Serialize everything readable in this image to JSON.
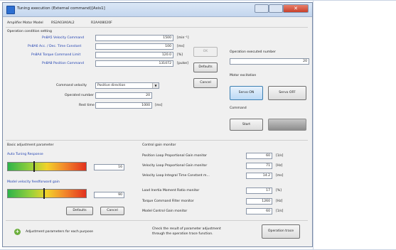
{
  "window": {
    "title": "Tuning execution (External command)[Axis1]",
    "close_glyph": "✕"
  },
  "amplifier": {
    "label": "Amplifier Motor Model",
    "amp_model": "RS2A03A0AL2",
    "motor_model": "R2AA08020F"
  },
  "operation": {
    "section_title": "Operation condition setting",
    "rows": [
      {
        "label": "Pn8A5 Velocity Command",
        "value": "1500",
        "unit": "[min⁻¹]"
      },
      {
        "label": "Pn8A6 Acc. / Dec. Time Constant",
        "value": "100",
        "unit": "[ms]"
      },
      {
        "label": "Pn8A4 Torque Command Limit",
        "value": "120.0",
        "unit": "[%]"
      },
      {
        "label": "Pn8A8 Position Command",
        "value": "131072",
        "unit": "[pulse]"
      }
    ],
    "command_velocity_label": "Command velocity",
    "command_velocity_value": "Positive direction",
    "operated_number_label": "Operated number",
    "operated_number_value": "20",
    "rest_time_label": "Rest time",
    "rest_time_value": "1000",
    "rest_time_unit": "[ms]",
    "ok_label": "OK",
    "to_defaults_label": "Defaults",
    "cancel_label": "Cancel"
  },
  "executed": {
    "label": "Operation executed number",
    "value": "20"
  },
  "motor_excitation": {
    "label": "Motor excitation",
    "servo_on_label": "Servo ON",
    "servo_off_label": "Servo OFF"
  },
  "command": {
    "label": "Command",
    "start_label": "Start"
  },
  "basic": {
    "section_title": "Basic adjustment parameter",
    "auto_label": "Auto Tuning Response",
    "auto_value": "16",
    "auto_level": 0.33,
    "model_label": "Model velocity feedforward gain",
    "model_value": "90",
    "model_level": 0.45,
    "defaults_label": "Defaults",
    "cancel_label": "Cancel"
  },
  "monitor": {
    "section_title": "Control gain monitor",
    "rows": [
      {
        "label": "Position Loop Proportional Gain monitor",
        "value": "60",
        "unit": "[1/s]"
      },
      {
        "label": "Velocity Loop Proportional Gain monitor",
        "value": "71",
        "unit": "[Hz]"
      },
      {
        "label": "Velocity Loop Integral Time Constant m...",
        "value": "14.2",
        "unit": "[ms]"
      },
      {
        "label": "Load Inertia Moment Ratio monitor",
        "value": "17",
        "unit": "[%]"
      },
      {
        "label": "Torque Command Filter monitor",
        "value": "1260",
        "unit": "[Hz]"
      },
      {
        "label": "Model Control Gain monitor",
        "value": "60",
        "unit": "[1/s]"
      }
    ]
  },
  "footer": {
    "adjustment_label": "Adjustment parameters for each purpose",
    "check_text_1": "Check the result of parameter adjustment",
    "check_text_2": "through the operation trace function.",
    "trace_button": "Operation trace"
  }
}
